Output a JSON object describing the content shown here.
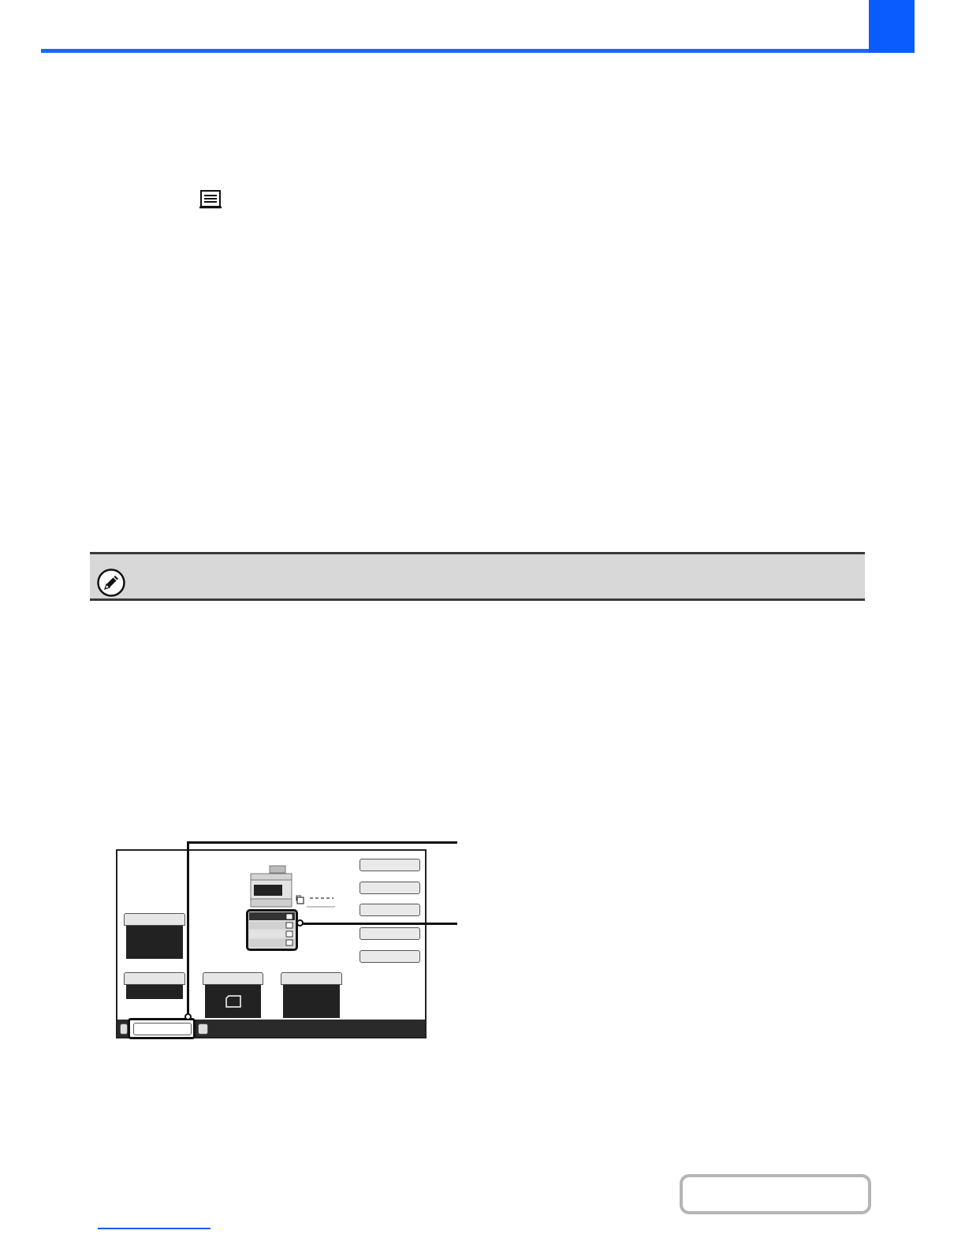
{
  "colors": {
    "header_rule": "#1a66ff",
    "chapter_tab": "#0a5cff",
    "note_bar": "#d8d8d8",
    "panel_dark": "#222222",
    "link_underline": "#2255ee"
  },
  "icons": {
    "inline": "paper-tray-icon",
    "note": "pencil-note-icon",
    "machine": "copier-machine-icon"
  }
}
